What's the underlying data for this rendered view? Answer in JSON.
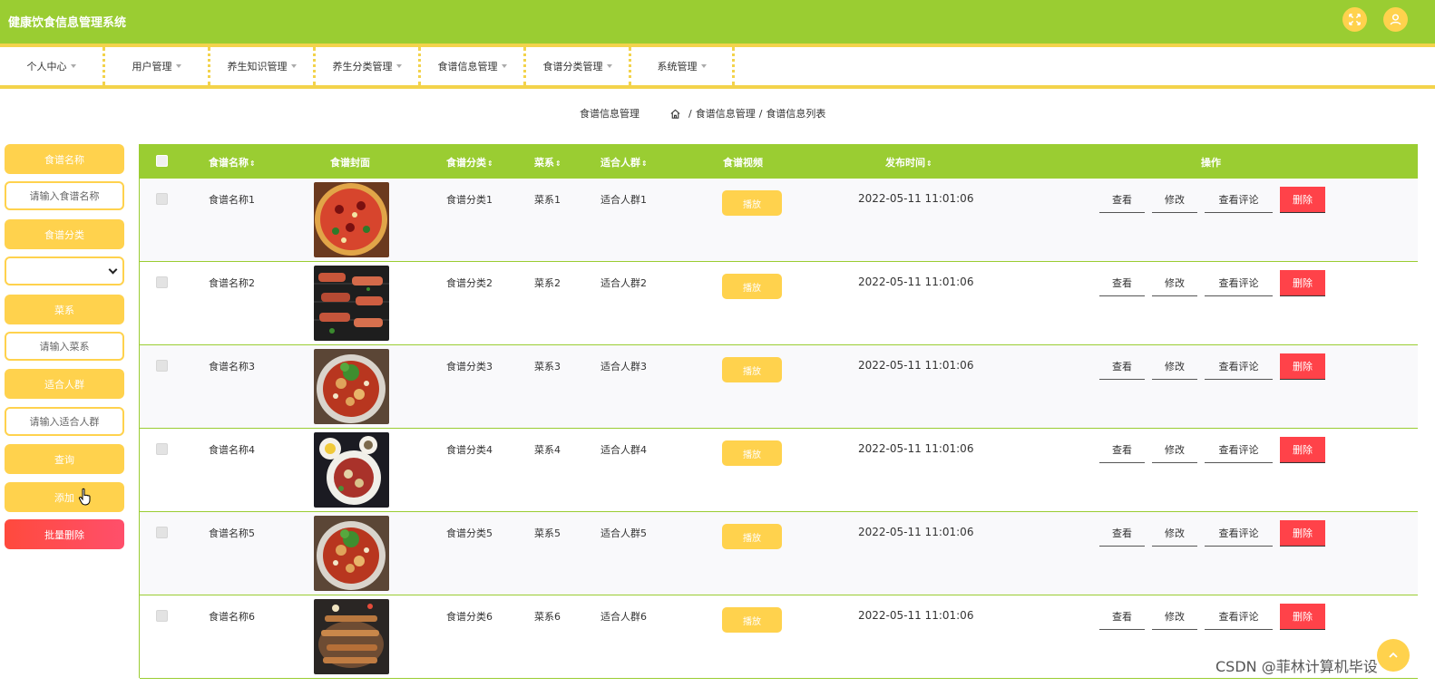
{
  "header": {
    "title": "健康饮食信息管理系统",
    "fullscreen_icon": "fullscreen-icon",
    "user_icon": "user-icon"
  },
  "nav": {
    "items": [
      {
        "label": "个人中心"
      },
      {
        "label": "用户管理"
      },
      {
        "label": "养生知识管理"
      },
      {
        "label": "养生分类管理"
      },
      {
        "label": "食谱信息管理"
      },
      {
        "label": "食谱分类管理"
      },
      {
        "label": "系统管理"
      }
    ]
  },
  "breadcrumb": {
    "title": "食谱信息管理",
    "home_icon": "home-icon",
    "path": [
      "食谱信息管理",
      "食谱信息列表"
    ],
    "separator": "/"
  },
  "search": {
    "name_label": "食谱名称",
    "name_placeholder": "请输入食谱名称",
    "category_label": "食谱分类",
    "category_value": "",
    "cuisine_label": "菜系",
    "cuisine_placeholder": "请输入菜系",
    "crowd_label": "适合人群",
    "crowd_placeholder": "请输入适合人群",
    "query_button": "查询",
    "add_button": "添加",
    "batch_delete_button": "批量删除"
  },
  "table": {
    "columns": [
      "食谱名称",
      "食谱封面",
      "食谱分类",
      "菜系",
      "适合人群",
      "食谱视频",
      "发布时间",
      "操作"
    ],
    "rows": [
      {
        "name": "食谱名称1",
        "category": "食谱分类1",
        "cuisine": "菜系1",
        "crowd": "适合人群1",
        "play": "播放",
        "time": "2022-05-11 11:01:06",
        "actions": [
          "查看",
          "修改",
          "查看评论",
          "删除"
        ],
        "cover": "pizza"
      },
      {
        "name": "食谱名称2",
        "category": "食谱分类2",
        "cuisine": "菜系2",
        "crowd": "适合人群2",
        "play": "播放",
        "time": "2022-05-11 11:01:06",
        "actions": [
          "查看",
          "修改",
          "查看评论",
          "删除"
        ],
        "cover": "bbq"
      },
      {
        "name": "食谱名称3",
        "category": "食谱分类3",
        "cuisine": "菜系3",
        "crowd": "适合人群3",
        "play": "播放",
        "time": "2022-05-11 11:01:06",
        "actions": [
          "查看",
          "修改",
          "查看评论",
          "删除"
        ],
        "cover": "spicy"
      },
      {
        "name": "食谱名称4",
        "category": "食谱分类4",
        "cuisine": "菜系4",
        "crowd": "适合人群4",
        "play": "播放",
        "time": "2022-05-11 11:01:06",
        "actions": [
          "查看",
          "修改",
          "查看评论",
          "删除"
        ],
        "cover": "plates"
      },
      {
        "name": "食谱名称5",
        "category": "食谱分类5",
        "cuisine": "菜系5",
        "crowd": "适合人群5",
        "play": "播放",
        "time": "2022-05-11 11:01:06",
        "actions": [
          "查看",
          "修改",
          "查看评论",
          "删除"
        ],
        "cover": "spicy"
      },
      {
        "name": "食谱名称6",
        "category": "食谱分类6",
        "cuisine": "菜系6",
        "crowd": "适合人群6",
        "play": "播放",
        "time": "2022-05-11 11:01:06",
        "actions": [
          "查看",
          "修改",
          "查看评论",
          "删除"
        ],
        "cover": "skewers"
      }
    ]
  },
  "footer": {
    "watermark": "CSDN @菲林计算机毕设",
    "back_top_icon": "arrow-up-icon"
  },
  "colors": {
    "primary": "#9acd32",
    "accent": "#ffd24d",
    "danger": "#ff4249"
  }
}
